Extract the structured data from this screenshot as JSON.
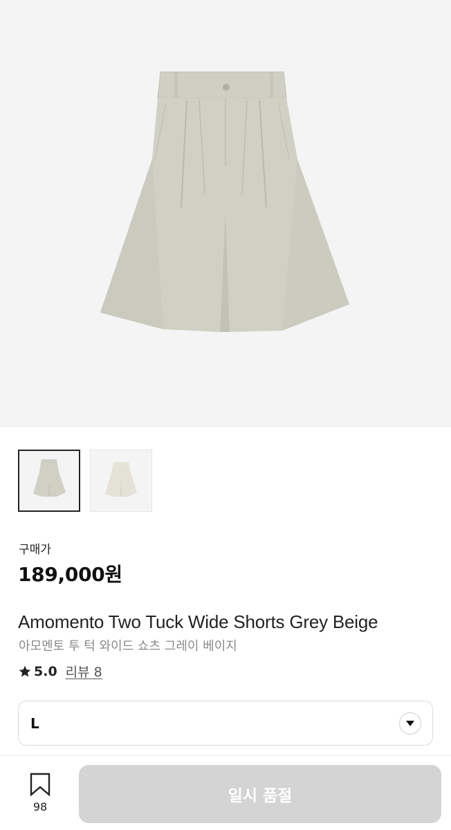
{
  "product": {
    "price_label": "구매가",
    "price": "189,000원",
    "title_en": "Amomento Two Tuck Wide Shorts Grey Beige",
    "title_ko": "아모멘토 투 턱 와이드 쇼츠 그레이 베이지",
    "rating": "5.0",
    "review_label": "리뷰 8"
  },
  "gallery": {
    "thumbnails": [
      {
        "selected": true,
        "garment_color": "#cfcfc4"
      },
      {
        "selected": false,
        "garment_color": "#e6e3da"
      }
    ],
    "main_garment_color": "#cfcfc4"
  },
  "options": {
    "size_selected": "L",
    "dropdown_icon": "chevron-down-icon"
  },
  "bottom_bar": {
    "wish_icon": "bookmark-icon",
    "wish_count": "98",
    "cta_label": "일시 품절",
    "cta_disabled": true
  },
  "colors": {
    "hero_bg": "#f4f4f4",
    "cta_disabled_bg": "#d4d4d4",
    "muted_text": "#8a8a8a"
  }
}
